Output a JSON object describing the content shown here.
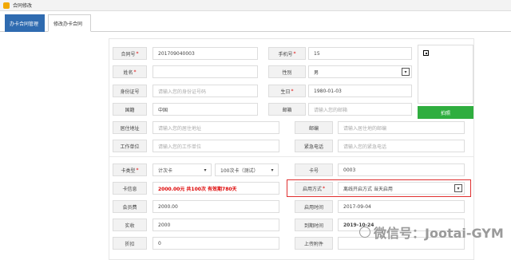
{
  "app": {
    "title": "合同修改"
  },
  "tabs": [
    {
      "label": "办卡合同管理"
    },
    {
      "label": "修改办卡合同"
    }
  ],
  "form": {
    "contract_no": {
      "label": "合同号",
      "value": "201709040003"
    },
    "phone": {
      "label": "手机号",
      "value": "15"
    },
    "name": {
      "label": "姓名"
    },
    "gender": {
      "label": "性别",
      "value": "男"
    },
    "id_card": {
      "label": "身份证号",
      "placeholder": "请输入您的身份证号码"
    },
    "birthday": {
      "label": "生日",
      "value": "1980-01-03"
    },
    "nationality": {
      "label": "国籍",
      "value": "中国"
    },
    "email": {
      "label": "邮箱",
      "placeholder": "请输入您的邮箱"
    },
    "address": {
      "label": "居住地址",
      "placeholder": "请输入您的居住地址"
    },
    "zip": {
      "label": "邮编",
      "placeholder": "请输入居住地的邮编"
    },
    "employer": {
      "label": "工作单位",
      "placeholder": "请输入您的工作单位"
    },
    "emergency_phone": {
      "label": "紧急电话",
      "placeholder": "请输入您的紧急电话"
    },
    "card_type": {
      "label": "卡类型",
      "value": "计次卡",
      "value2": "100次卡（测试）"
    },
    "card_no": {
      "label": "卡号",
      "value": "0003"
    },
    "card_info": {
      "label": "卡信息",
      "value": "2000.00元 共100次 有效期780天"
    },
    "activation": {
      "label": "启用方式",
      "value": "离线开启方式 当天启用"
    },
    "fee": {
      "label": "会员费",
      "value": "2000.00"
    },
    "start_time": {
      "label": "启用时间",
      "value": "2017-09-04"
    },
    "paid": {
      "label": "实收",
      "value": "2000"
    },
    "end_time": {
      "label": "到期时间",
      "value": "2019-10-24"
    },
    "discount": {
      "label": "折扣",
      "value": "0"
    },
    "attachment": {
      "label": "上传附件"
    }
  },
  "photo_button": "拍照",
  "watermark": "微信号：Jootai-GYM",
  "required_mark": "*"
}
